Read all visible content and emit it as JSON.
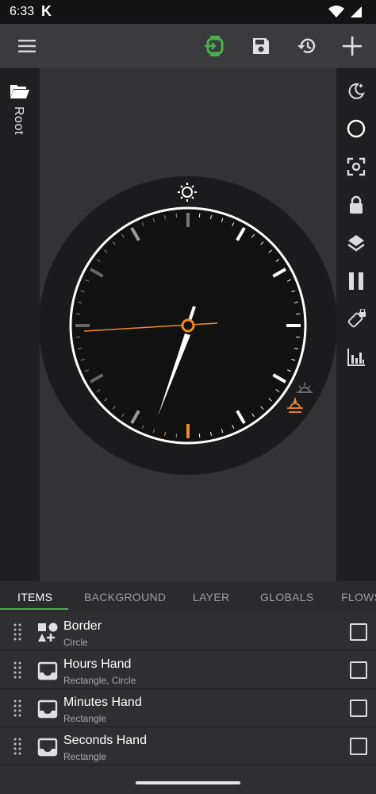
{
  "status_bar": {
    "time": "6:33",
    "app_badge": "K"
  },
  "toolbar": {
    "icons": [
      "menu-icon",
      "watch-sync-icon",
      "save-icon",
      "history-icon",
      "add-icon"
    ],
    "accent_color": "#4caf50"
  },
  "left_panel": {
    "root_label": "Root",
    "icon": "folder-open-icon"
  },
  "right_panel": {
    "icons": [
      "night-mode-icon",
      "circle-icon",
      "focus-icon",
      "lock-icon",
      "layers-icon",
      "pause-icon",
      "rotate-lock-icon",
      "bar-chart-icon"
    ]
  },
  "watch_face": {
    "time_shown": {
      "hours": "6",
      "minutes": "34",
      "seconds": "46"
    },
    "accent_color": "#f28a1c",
    "icons": [
      "sun-icon",
      "sunrise-icon",
      "sunset-icon"
    ]
  },
  "tabs": [
    {
      "label": "ITEMS",
      "active": true
    },
    {
      "label": "BACKGROUND",
      "active": false
    },
    {
      "label": "LAYER",
      "active": false
    },
    {
      "label": "GLOBALS",
      "active": false
    },
    {
      "label": "FLOWS",
      "active": false
    }
  ],
  "items": [
    {
      "title": "Border",
      "subtitle": "Circle",
      "icon": "shapes-icon",
      "checked": false
    },
    {
      "title": "Hours Hand",
      "subtitle": "Rectangle, Circle",
      "icon": "inbox-icon",
      "checked": false
    },
    {
      "title": "Minutes Hand",
      "subtitle": "Rectangle",
      "icon": "inbox-icon",
      "checked": false
    },
    {
      "title": "Seconds Hand",
      "subtitle": "Rectangle",
      "icon": "inbox-icon",
      "checked": false
    }
  ]
}
